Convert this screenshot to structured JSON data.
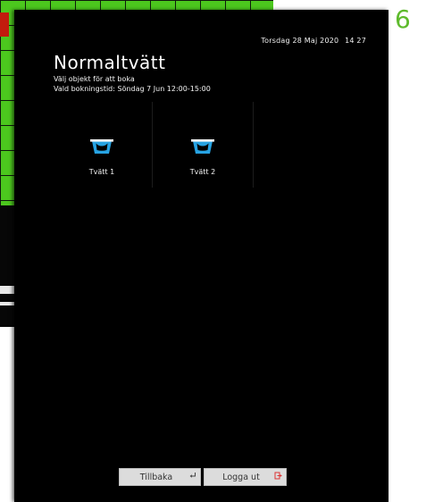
{
  "step_number": "6",
  "header": {
    "clock_date": "Torsdag 28 Maj 2020",
    "clock_time": "14 27"
  },
  "screen": {
    "title": "Normaltvätt",
    "instruction": "Välj objekt för att boka",
    "selected_time": "Vald bokningstid: Söndag 7 Jun 12:00-15:00"
  },
  "objects": [
    {
      "label": "Tvätt 1",
      "icon": "washing-tub-icon"
    },
    {
      "label": "Tvätt 2",
      "icon": "washing-tub-icon"
    }
  ],
  "footer": {
    "back_label": "Tillbaka",
    "back_icon": "return-arrow-icon",
    "logout_label": "Logga ut",
    "logout_icon": "exit-icon"
  },
  "colors": {
    "accent_green": "#5eba2c",
    "grid_green": "#4cc81e",
    "icon_blue": "#27a3e3",
    "button_gray": "#dcdcdc",
    "background": "#000000"
  }
}
